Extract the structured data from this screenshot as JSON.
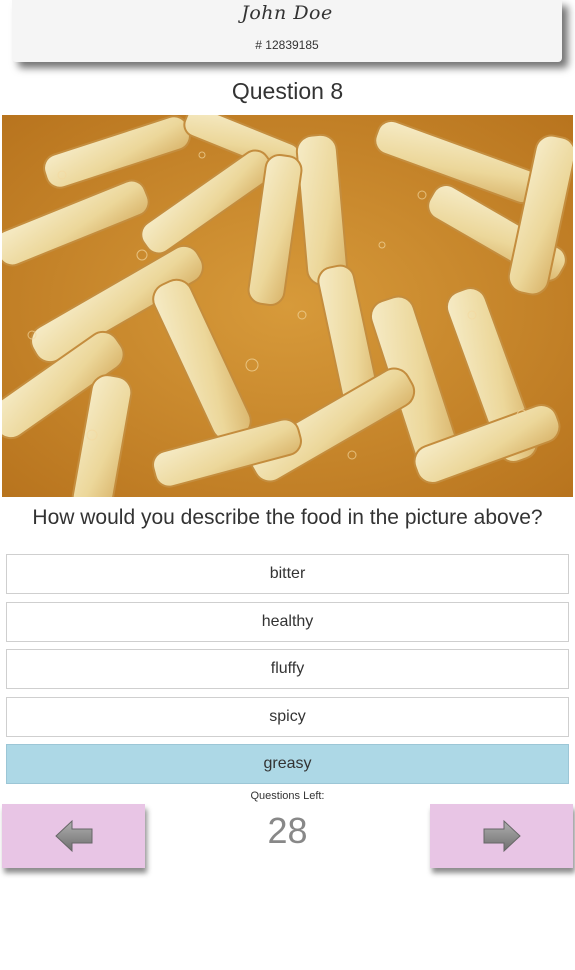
{
  "header": {
    "user_name": "John Doe",
    "user_id": "# 12839185"
  },
  "question": {
    "title": "Question 8",
    "image_icon": "food-photo-french-fries",
    "prompt": "How would you describe the food in the picture above?"
  },
  "answers": [
    {
      "label": "bitter",
      "selected": false
    },
    {
      "label": "healthy",
      "selected": false
    },
    {
      "label": "fluffy",
      "selected": false
    },
    {
      "label": "spicy",
      "selected": false
    },
    {
      "label": "greasy",
      "selected": true
    }
  ],
  "footer": {
    "questions_left_label": "Questions Left:",
    "questions_left_count": "28",
    "prev_icon": "arrow-left-icon",
    "next_icon": "arrow-right-icon"
  },
  "colors": {
    "selected_answer": "#add8e6",
    "nav_button": "#e8c5e5"
  }
}
